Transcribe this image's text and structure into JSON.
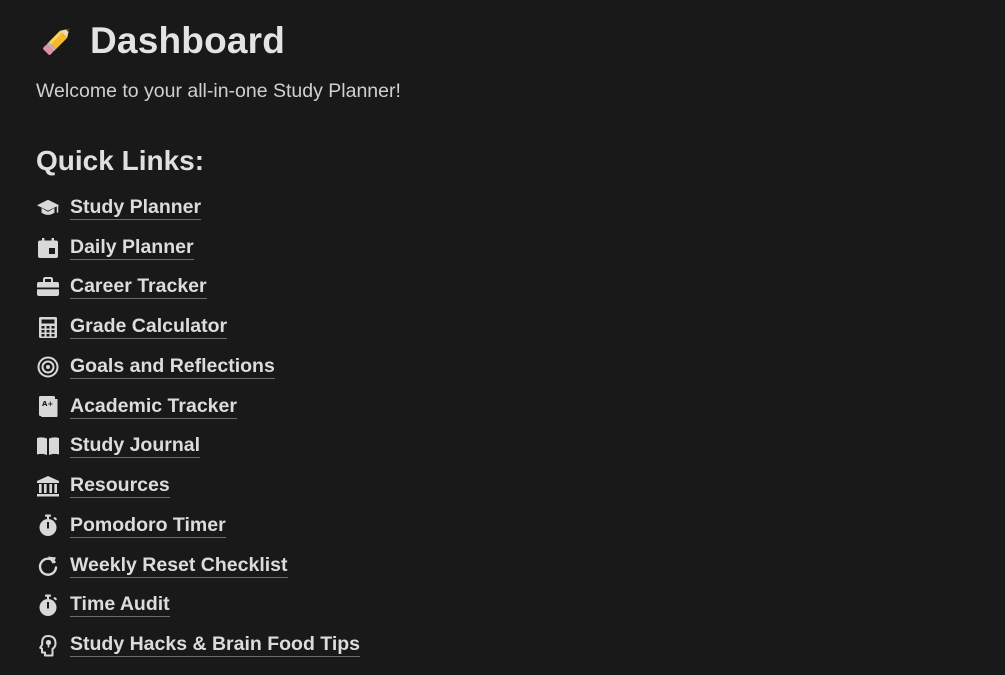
{
  "header": {
    "icon": "pencil-icon",
    "title": "Dashboard",
    "welcome": "Welcome to your all-in-one Study Planner!"
  },
  "quick_links": {
    "heading": "Quick Links:",
    "items": [
      {
        "label": "Study Planner",
        "icon": "graduation-cap-icon"
      },
      {
        "label": "Daily Planner",
        "icon": "calendar-icon"
      },
      {
        "label": "Career Tracker",
        "icon": "briefcase-icon"
      },
      {
        "label": "Grade Calculator",
        "icon": "calculator-icon"
      },
      {
        "label": "Goals and Reflections",
        "icon": "target-icon"
      },
      {
        "label": "Academic Tracker",
        "icon": "report-card-icon"
      },
      {
        "label": "Study Journal",
        "icon": "open-book-icon"
      },
      {
        "label": "Resources",
        "icon": "building-columns-icon"
      },
      {
        "label": "Pomodoro Timer",
        "icon": "stopwatch-icon"
      },
      {
        "label": "Weekly Reset Checklist",
        "icon": "refresh-icon"
      },
      {
        "label": "Time Audit",
        "icon": "stopwatch-icon"
      },
      {
        "label": "Study Hacks & Brain Food Tips",
        "icon": "brain-head-icon"
      }
    ]
  },
  "colors": {
    "background": "#191919",
    "text": "#d4d4d4",
    "link_underline": "#6a6a6a"
  }
}
